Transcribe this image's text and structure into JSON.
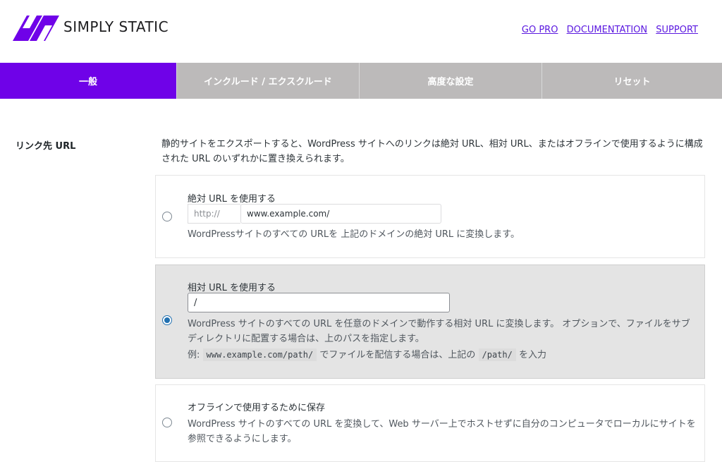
{
  "header": {
    "brand": "SIMPLY STATIC",
    "links": [
      "GO PRO",
      "DOCUMENTATION",
      "SUPPORT"
    ]
  },
  "tabs": [
    "一般",
    "インクルード / エクスクルード",
    "高度な設定",
    "リセット"
  ],
  "active_tab": "一般",
  "section": {
    "label": "リンク先 URL",
    "description": "静的サイトをエクスポートすると、WordPress サイトへのリンクは絶対 URL、相対 URL、またはオフラインで使用するように構成された URL のいずれかに置き換えられます。"
  },
  "options": {
    "absolute": {
      "title": "絶対 URL を使用する",
      "scheme_placeholder": "http://",
      "host_value": "www.example.com/",
      "text": "WordPressサイトのすべての URLを 上記のドメインの絶対 URL に変換します。",
      "checked": false
    },
    "relative": {
      "title": "相対 URL を使用する",
      "path_value": "/",
      "text": "WordPress サイトのすべての URL を任意のドメインで動作する相対 URL に変換します。 オプションで、ファイルをサブディレクトリに配置する場合は、上のパスを指定します。",
      "example_prefix": "例: ",
      "example_code": "www.example.com/path/",
      "example_middle": " でファイルを配信する場合は、上記の ",
      "example_code2": "/path/",
      "example_suffix": " を入力",
      "checked": true
    },
    "offline": {
      "title": "オフラインで使用するために保存",
      "text": "WordPress サイトのすべての URL を変換して、Web サーバー上でホストせずに自分のコンピュータでローカルにサイトを参照できるようにします。",
      "checked": false
    }
  },
  "colors": {
    "accent": "#6f02e8",
    "tab_inactive": "#bcbaba",
    "link": "#5b19e0",
    "radio": "#2271b1"
  }
}
